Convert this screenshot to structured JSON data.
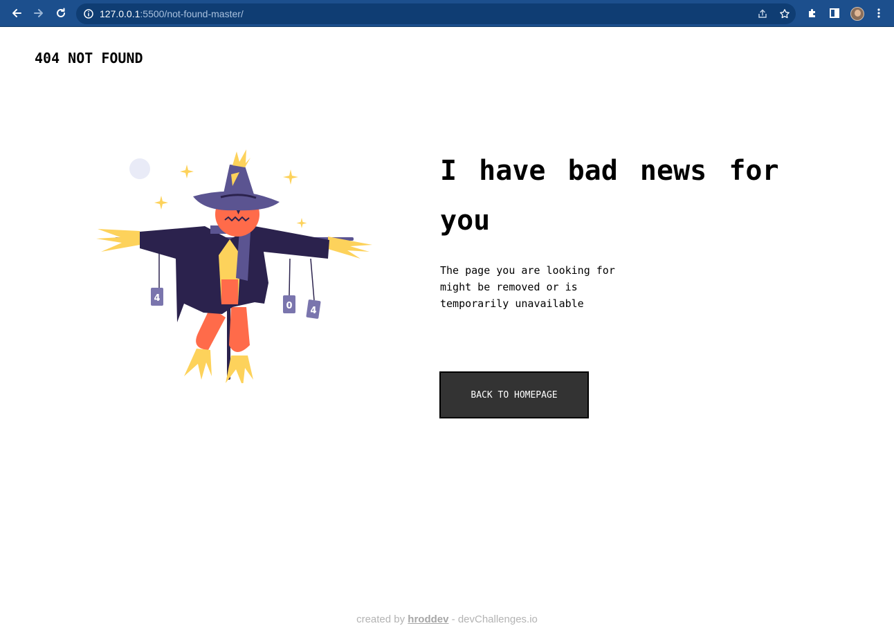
{
  "browser": {
    "url_host": "127.0.0.1",
    "url_rest": ":5500/not-found-master/",
    "icons": [
      "back-icon",
      "forward-icon",
      "reload-icon",
      "info-icon",
      "share-icon",
      "star-icon",
      "extensions-icon",
      "side-panel-icon",
      "profile-avatar",
      "menu-icon"
    ]
  },
  "page": {
    "brand": "404 NOT FOUND",
    "headline": "I have bad news for you",
    "description": "The page you are looking for might be removed or is temporarily unavailable",
    "button_label": "BACK TO HOMEPAGE"
  },
  "illustration": {
    "subject": "scarecrow",
    "can_labels": [
      "4",
      "0",
      "4"
    ]
  },
  "footer": {
    "prefix": "created by",
    "author": "hroddev",
    "suffix": "- devChallenges.io"
  },
  "colors": {
    "chrome": "#1c4f8d",
    "button_bg": "#333333",
    "hat": "#5b5491",
    "coat": "#2b224d",
    "pumpkin": "#ff6b4a",
    "straw": "#fdd25b"
  }
}
